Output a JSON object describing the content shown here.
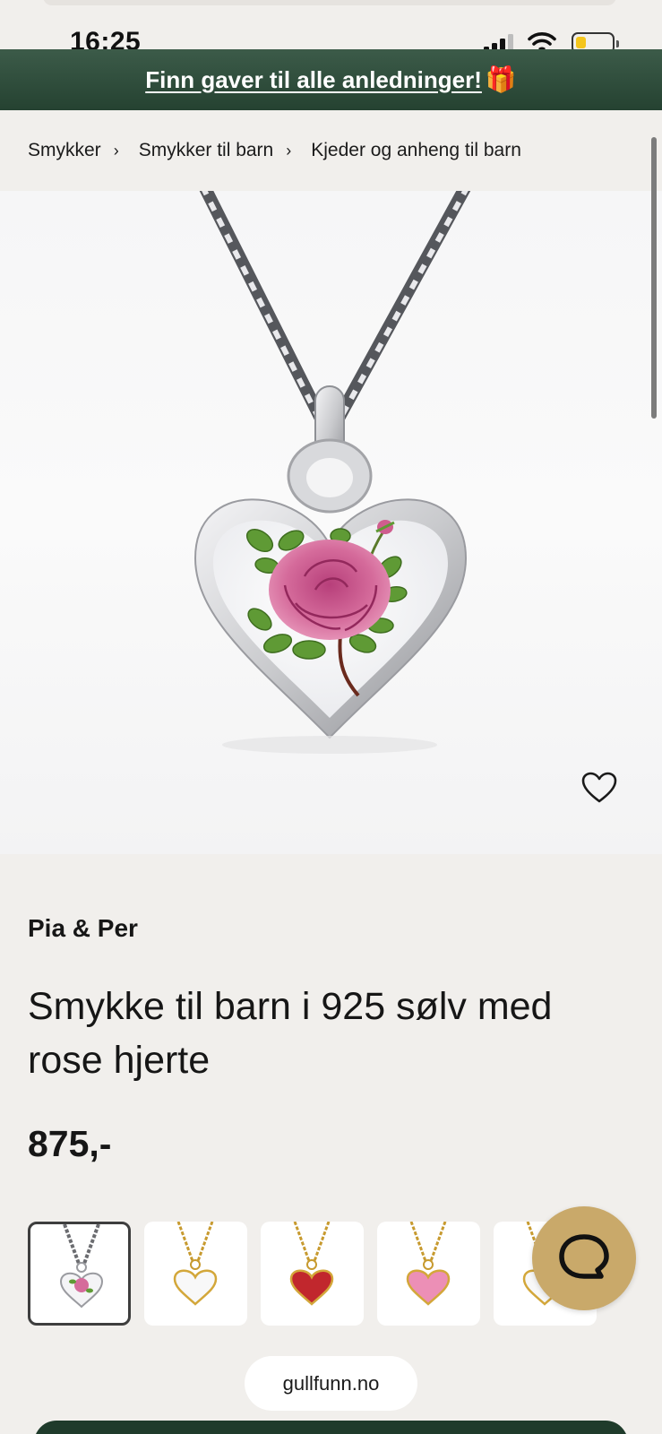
{
  "status_bar": {
    "time": "16:25"
  },
  "promo": {
    "text": "Finn gaver til alle anledninger!",
    "icon": "gift-icon"
  },
  "breadcrumb": {
    "items": [
      "Smykker",
      "Smykker til barn",
      "Kjeder og anheng til barn"
    ],
    "separator": "›"
  },
  "product": {
    "brand": "Pia & Per",
    "title": "Smykke til barn i 925 sølv med rose hjerte",
    "price": "875,-",
    "wishlist_icon": "heart-outline-icon"
  },
  "variants": [
    {
      "chain": "silver",
      "heart": "white-rose",
      "selected": true
    },
    {
      "chain": "gold",
      "heart": "white",
      "selected": false
    },
    {
      "chain": "gold",
      "heart": "red",
      "selected": false
    },
    {
      "chain": "gold",
      "heart": "pink",
      "selected": false
    },
    {
      "chain": "gold",
      "heart": "white",
      "selected": false
    }
  ],
  "chat": {
    "icon": "chat-bubble-icon"
  },
  "browser": {
    "url": "gullfunn.no"
  },
  "colors": {
    "banner": "#2f4d3b",
    "background": "#f1efec",
    "chat_button": "#c9a96a",
    "text": "#161616"
  }
}
